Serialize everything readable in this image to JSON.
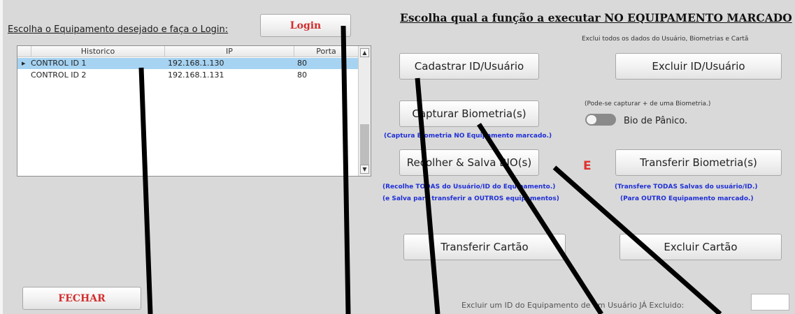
{
  "left": {
    "prompt_label": "Escolha o Equipamento desejado e faça o Login:",
    "login_button": "Login",
    "close_button": "FECHAR"
  },
  "grid": {
    "columns": [
      "Historico",
      "IP",
      "Porta"
    ],
    "rows": [
      {
        "historico": "CONTROL ID 1",
        "ip": "192.168.1.130",
        "porta": "80",
        "selected": true
      },
      {
        "historico": "CONTROL ID 2",
        "ip": "192.168.1.131",
        "porta": "80",
        "selected": false
      }
    ]
  },
  "right": {
    "title": "Escolha qual a função a executar NO EQUIPAMENTO MARCADO",
    "excluir_note": "Exclui todos os dados do Usuário, Biometrias e Cartã",
    "cadastrar_button": "Cadastrar ID/Usuário",
    "excluir_button": "Excluir ID/Usuário",
    "capturar_button": "Capturar Biometria(s)",
    "capture_hint": "(Pode-se capturar + de uma Biometria.)",
    "panico_label": "Bio de Pânico.",
    "capture_blue_note": "(Captura Biometria NO Equipamento marcado.)",
    "recolher_button": "Recolher & Salva BIO(s)",
    "e_marker": "E",
    "transferir_bio_button": "Transferir Biometria(s)",
    "recolher_note_1": "(Recolhe TODAS do Usuário/ID do Equipamento.)",
    "recolher_note_2": "(e Salva para transferir a OUTROS equipamentos)",
    "transfer_note_1": "(Transfere TODAS Salvas do usuário/ID.)",
    "transfer_note_2": "(Para OUTRO Equipamento marcado.)",
    "transferir_cartao_button": "Transferir Cartão",
    "excluir_cartao_button": "Excluir Cartão",
    "excluir_id_label": "Excluir um ID do Equipamento de um Usuário JÁ Excluido:",
    "excluir_id_value": ""
  },
  "colors": {
    "panel_bg": "#d9d9d9",
    "red_text": "#d42d2d",
    "blue_text": "#1f2fd6",
    "selection": "#a6d3f2"
  }
}
